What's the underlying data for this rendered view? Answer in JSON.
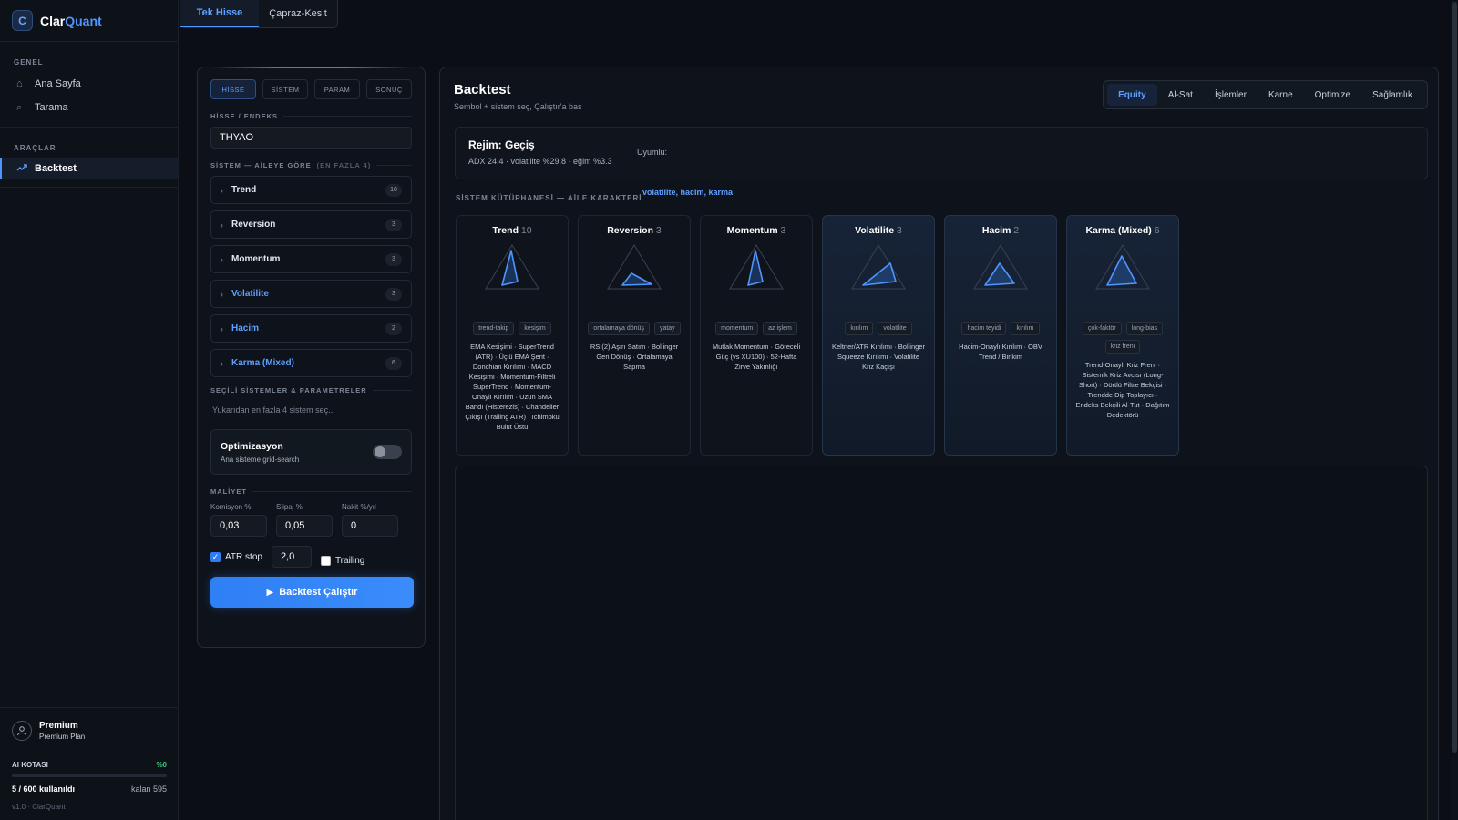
{
  "app": {
    "logo_letter": "C",
    "name_part1": "Clar",
    "name_part2": "Quant",
    "accent": "#4f95ff"
  },
  "sidebar": {
    "sections": [
      {
        "caption": "GENEL",
        "items": [
          {
            "label": "Ana Sayfa",
            "icon": "home-icon"
          },
          {
            "label": "Tarama",
            "icon": "search-icon"
          }
        ]
      },
      {
        "caption": "ARAÇLAR",
        "items": [
          {
            "label": "Backtest",
            "icon": "chart-line-icon",
            "active": true
          }
        ]
      }
    ],
    "user": {
      "name": "Premium",
      "plan": "Premium Plan"
    },
    "quota": {
      "label": "AI KOTASI",
      "percent_text": "%0",
      "fraction_used": 0,
      "used_text": "5 / 600 kullanıldı",
      "left_text": "kalan 595"
    },
    "version": "v1.0 · ClarQuant"
  },
  "top_tabs": [
    {
      "label": "Tek Hisse",
      "active": true
    },
    {
      "label": "Çapraz-Kesit",
      "active": false
    }
  ],
  "left_panel": {
    "step_tabs": [
      {
        "label": "HİSSE",
        "active": true
      },
      {
        "label": "SİSTEM"
      },
      {
        "label": "PARAM"
      },
      {
        "label": "SONUÇ"
      }
    ],
    "symbol_caption": "HİSSE / ENDEKS",
    "symbol_value": "THYAO",
    "system_caption": "SİSTEM — AİLEYE GÖRE",
    "system_caption_note": "(EN FAZLA 4)",
    "families": [
      {
        "name": "Trend",
        "count": "10",
        "highlight": false
      },
      {
        "name": "Reversion",
        "count": "3",
        "highlight": false
      },
      {
        "name": "Momentum",
        "count": "3",
        "highlight": false
      },
      {
        "name": "Volatilite",
        "count": "3",
        "highlight": true
      },
      {
        "name": "Hacim",
        "count": "2",
        "highlight": true
      },
      {
        "name": "Karma (Mixed)",
        "count": "6",
        "highlight": true
      }
    ],
    "selected_caption": "SEÇİLİ SİSTEMLER & PARAMETRELER",
    "selected_hint": "Yukarıdan en fazla 4 sistem seç...",
    "optimization": {
      "title": "Optimizasyon",
      "subtitle": "Ana sisteme grid-search",
      "enabled": false
    },
    "cost_caption": "MALİYET",
    "costs": [
      {
        "label": "Komisyon %",
        "value": "0,03"
      },
      {
        "label": "Slipaj %",
        "value": "0,05"
      },
      {
        "label": "Nakit %/yıl",
        "value": "0"
      }
    ],
    "atr_stop": {
      "label": "ATR stop",
      "checked": true,
      "value": "2,0"
    },
    "trailing": {
      "label": "Trailing",
      "checked": false
    },
    "run_label": "Backtest Çalıştır"
  },
  "main": {
    "title": "Backtest",
    "subtitle": "Sembol + sistem seç, Çalıştır'a bas",
    "result_tabs": [
      {
        "label": "Equity",
        "active": true
      },
      {
        "label": "Al-Sat"
      },
      {
        "label": "İşlemler"
      },
      {
        "label": "Karne"
      },
      {
        "label": "Optimize"
      },
      {
        "label": "Sağlamlık"
      }
    ],
    "regime": {
      "title": "Rejim: Geçiş",
      "stats": "ADX 24.4 · volatilite %29.8 · eğim %3.3",
      "compat_label": "Uyumlu:",
      "compat_tags": "volatilite, hacim, karma"
    },
    "library_caption": "SİSTEM KÜTÜPHANESİ — AİLE KARAKTERİ",
    "cards": [
      {
        "name": "Trend",
        "count": "10",
        "tags": [
          "trend-takip",
          "kesişim"
        ],
        "desc": "EMA Kesişimi · SuperTrend (ATR) · Üçlü EMA Şerit · Donchian Kırılımı · MACD Kesişimi · Momentum-Filtreli SuperTrend · Momentum-Onaylı Kırılım · Uzun SMA Bandı (Histerezis) · Chandelier Çıkışı (Trailing ATR) · Ichimoku Bulut Üstü",
        "highlight": false
      },
      {
        "name": "Reversion",
        "count": "3",
        "tags": [
          "ortalamaya dönüş",
          "yatay"
        ],
        "desc": "RSI(2) Aşırı Satım · Bollinger Geri Dönüş · Ortalamaya Sapma",
        "highlight": false
      },
      {
        "name": "Momentum",
        "count": "3",
        "tags": [
          "momentum",
          "az işlem"
        ],
        "desc": "Mutlak Momentum · Göreceli Güç (vs XU100) · 52-Hafta Zirve Yakınlığı",
        "highlight": false
      },
      {
        "name": "Volatilite",
        "count": "3",
        "tags": [
          "kırılım",
          "volatilite"
        ],
        "desc": "Keltner/ATR Kırılımı · Bollinger Squeeze Kırılımı · Volatilite Kriz Kaçışı",
        "highlight": true
      },
      {
        "name": "Hacim",
        "count": "2",
        "tags": [
          "hacim teyidi",
          "kırılım"
        ],
        "desc": "Hacim-Onaylı Kırılım · OBV Trend / Birikim",
        "highlight": true
      },
      {
        "name": "Karma (Mixed)",
        "count": "6",
        "tags": [
          "çok-faktör",
          "long-bias",
          "kriz freni"
        ],
        "desc": "Trend-Onaylı Kriz Freni · Sistemik Kriz Avcısı (Long-Short) · Dörtlü Filtre Bekçisi · Trendde Dip Toplayıcı · Endeks Bekçili Al-Tut · Dağıtım Dedektörü",
        "highlight": true
      }
    ]
  }
}
